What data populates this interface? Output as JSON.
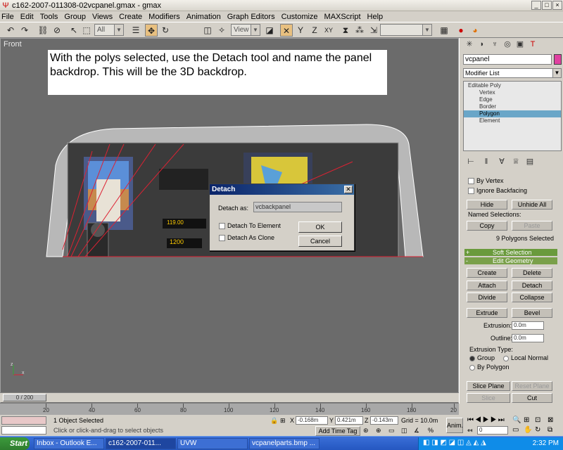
{
  "window": {
    "title": "c162-2007-011308-02vcpanel.gmax - gmax",
    "min": "_",
    "max": "□",
    "close": "×"
  },
  "menu": [
    "File",
    "Edit",
    "Tools",
    "Group",
    "Views",
    "Create",
    "Modifiers",
    "Animation",
    "Graph Editors",
    "Customize",
    "MAXScript",
    "Help"
  ],
  "toolbar": {
    "selection_filter": "All",
    "ref_coord": "View",
    "named_sel": ""
  },
  "viewport": {
    "label": "Front",
    "annotation": "With the polys selected, use the Detach tool and name the panel backdrop.  This will be the 3D backdrop.",
    "axis_x": "x",
    "axis_z": "z"
  },
  "dialog": {
    "title": "Detach",
    "detach_as_label": "Detach as:",
    "detach_as_value": "vcbackpanel",
    "to_element": "Detach To Element",
    "as_clone": "Detach As Clone",
    "ok": "OK",
    "cancel": "Cancel"
  },
  "command_panel": {
    "object_name": "vcpanel",
    "modifier_list": "Modifier List",
    "stack": [
      "Editable Poly",
      "Vertex",
      "Edge",
      "Border",
      "Polygon",
      "Element"
    ],
    "by_vertex": "By Vertex",
    "ignore_backfacing": "Ignore Backfacing",
    "hide": "Hide",
    "unhide_all": "Unhide All",
    "named_selections": "Named Selections:",
    "copy": "Copy",
    "paste": "Paste",
    "selected_info": "9 Polygons Selected",
    "soft_selection": "Soft Selection",
    "edit_geometry": "Edit Geometry",
    "create": "Create",
    "delete": "Delete",
    "attach": "Attach",
    "detach": "Detach",
    "divide": "Divide",
    "collapse": "Collapse",
    "extrude": "Extrude",
    "bevel": "Bevel",
    "extrusion_label": "Extrusion:",
    "extrusion_value": "0.0m",
    "outline_label": "Outline:",
    "outline_value": "0.0m",
    "extrusion_type": "Extrusion Type:",
    "group": "Group",
    "local_normal": "Local Normal",
    "by_polygon": "By Polygon",
    "slice_plane": "Slice Plane",
    "reset_plane": "Reset Plane",
    "slice": "Slice",
    "cut": "Cut",
    "split": "Split",
    "rollup_plus": "+",
    "rollup_minus": "-"
  },
  "timeline": {
    "frame": "0 / 200",
    "ticks": [
      "20",
      "40",
      "60",
      "80",
      "100",
      "120",
      "140",
      "160",
      "180",
      "20"
    ]
  },
  "status": {
    "selected": "1 Object Selected",
    "prompt": "Click or click-and-drag to select objects",
    "x_label": "X",
    "x": "-0.168m",
    "y_label": "Y",
    "y": "0.421m",
    "z_label": "Z",
    "z": "-0.143m",
    "grid": "Grid = 10.0m",
    "add_time_tag": "Add Time Tag",
    "anim": "Anim.",
    "frame_value": "0"
  },
  "taskbar": {
    "start": "Start",
    "items": [
      "Inbox - Outlook E...",
      "c162-2007-011...",
      "UVW",
      "vcpanelparts.bmp ..."
    ],
    "clock": "2:32 PM"
  }
}
